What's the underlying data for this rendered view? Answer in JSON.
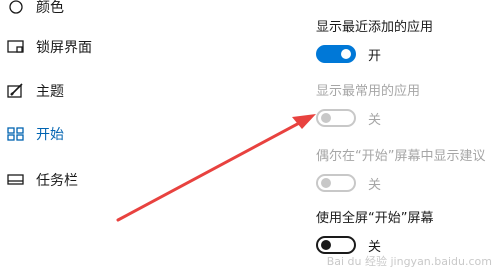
{
  "sidebar": {
    "items": [
      {
        "label": "颜色",
        "icon": "palette-icon"
      },
      {
        "label": "锁屏界面",
        "icon": "lock-screen-icon"
      },
      {
        "label": "主题",
        "icon": "theme-brush-icon"
      },
      {
        "label": "开始",
        "icon": "start-menu-icon",
        "active": true
      },
      {
        "label": "任务栏",
        "icon": "taskbar-icon"
      }
    ]
  },
  "settings": [
    {
      "title": "显示最近添加的应用",
      "state": "开",
      "mode": "on"
    },
    {
      "title": "显示最常用的应用",
      "state": "关",
      "mode": "disabled"
    },
    {
      "title": "偶尔在“开始”屏幕中显示建议",
      "state": "关",
      "mode": "disabled"
    },
    {
      "title": "使用全屏“开始”屏幕",
      "state": "关",
      "mode": "off"
    }
  ],
  "watermark": "Bai du 经验 jingyan.baidu.com",
  "colors": {
    "accent": "#0078d7",
    "active_nav": "#0063b1",
    "arrow": "#e8423f",
    "disabled": "#a6a6a6"
  }
}
